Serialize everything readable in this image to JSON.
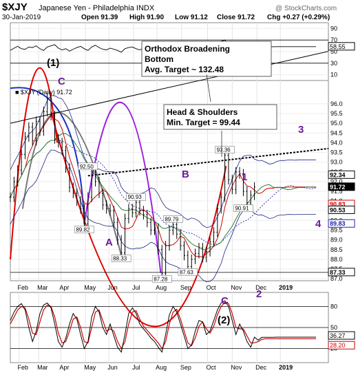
{
  "chart_data": {
    "type": "line",
    "title": "$XJY",
    "subtitle": "Japanese Yen - Philadelphia  INDX",
    "watermark": "@ StockCharts.com",
    "header": {
      "date": "30-Jan-2019",
      "open": "Open 91.39",
      "high": "High 91.90",
      "low": "Low 91.12",
      "close": "Close 91.72",
      "chg": "Chg +0.27 (+0.29%)"
    },
    "colors": {
      "price": "#000000",
      "ma_fast": "#cc0000",
      "ma_slow": "#2e7d32",
      "band": "#1a237e",
      "mid_band": "#2222aa",
      "annotation": "#6a1b9a",
      "red_cycle": "#e00000",
      "blue_cycle": "#1530c8",
      "purple_cycle": "#9c1ee0",
      "grey_cycle": "#777777",
      "oscillator_k": "#000000",
      "oscillator_d": "#cc0000"
    },
    "months": [
      "Feb",
      "Mar",
      "Apr",
      "May",
      "Jun",
      "Jul",
      "Aug",
      "Sep",
      "Oct",
      "Nov",
      "Dec",
      "2019"
    ],
    "price_panel": {
      "legend": "■ $XJY (Daily) 91.72",
      "ylim": [
        86.9,
        97.2
      ],
      "yticks": [
        "87.0",
        "87.5",
        "88.0",
        "88.5",
        "89.0",
        "89.5",
        "90.0",
        "90.5",
        "91.0",
        "91.5",
        "92.0",
        "92.5",
        "93.0",
        "93.5",
        "94.0",
        "94.5",
        "95.0",
        "95.5",
        "96.0"
      ],
      "price_labels": [
        "92.34",
        "91.72",
        "90.83",
        "90.53",
        "89.83",
        "87.33"
      ],
      "series": {
        "x": [
          0,
          3,
          6,
          9,
          12,
          15,
          18,
          21,
          24,
          27,
          30,
          33,
          36,
          39,
          42,
          45,
          48,
          51,
          54,
          57,
          60,
          63,
          66,
          69,
          72,
          75,
          78,
          81,
          84,
          87,
          90,
          93,
          96,
          99,
          102,
          105,
          108,
          111,
          114,
          117,
          120,
          123,
          126,
          129,
          132,
          135,
          138,
          141,
          144,
          147,
          150,
          153,
          156,
          159,
          162,
          165,
          168,
          171,
          174,
          177,
          180,
          183,
          186,
          189,
          192,
          195,
          198,
          201,
          204,
          207,
          210,
          213,
          216,
          219,
          222,
          225,
          228,
          231,
          234,
          237,
          240,
          243,
          246,
          248
        ],
        "values": [
          91.2,
          92.0,
          92.6,
          93.4,
          94.3,
          94.8,
          94.1,
          95.1,
          94.6,
          95.6,
          96.3,
          95.4,
          94.2,
          94.0,
          93.6,
          92.7,
          91.7,
          91.4,
          91.0,
          90.6,
          89.82,
          91.2,
          92.5,
          92.0,
          91.4,
          90.8,
          90.6,
          90.5,
          89.9,
          89.0,
          88.33,
          90.1,
          90.6,
          90.4,
          90.93,
          90.5,
          90.3,
          89.9,
          89.5,
          89.6,
          88.5,
          87.28,
          88.7,
          89.5,
          89.79,
          89.3,
          88.7,
          88.2,
          87.63,
          88.0,
          88.3,
          88.6,
          88.1,
          88.4,
          88.9,
          89.4,
          90.6,
          91.2,
          93.36,
          92.1,
          91.6,
          92.5,
          92.4,
          91.5,
          90.91,
          91.3,
          91.72,
          91.5,
          91.7,
          91.8,
          91.6,
          91.7,
          91.72,
          91.72,
          91.72,
          91.72,
          91.72,
          91.72,
          91.72,
          91.72,
          91.72,
          91.72,
          91.72,
          91.72
        ]
      },
      "annotations": [
        {
          "label": "89.82",
          "x": 60,
          "y": 89.82
        },
        {
          "label": "92.50",
          "x": 63,
          "y": 92.5
        },
        {
          "label": "88.33",
          "x": 90,
          "y": 88.33
        },
        {
          "label": "90.93",
          "x": 102,
          "y": 90.93
        },
        {
          "label": "89.79",
          "x": 132,
          "y": 89.79
        },
        {
          "label": "87.28",
          "x": 123,
          "y": 87.28
        },
        {
          "label": "87.63",
          "x": 144,
          "y": 87.63
        },
        {
          "label": "93.36",
          "x": 174,
          "y": 93.36
        },
        {
          "label": "90.91",
          "x": 189,
          "y": 90.91
        }
      ],
      "text_callouts": {
        "orthodox": "Orthodox Broadening\nBottom\nAvg. Target ~ 132.48",
        "head_shoulders": "Head & Shoulders\nMin. Target = 99.44"
      },
      "wave_labels": [
        "C",
        "A",
        "B",
        "1",
        "C",
        "2",
        "3",
        "4"
      ],
      "wave_sublabel": "(1)"
    },
    "rsi_panel": {
      "yticks": [
        "10",
        "30",
        "50",
        "70",
        "90"
      ],
      "value_label": "58.55",
      "values": [
        52,
        56,
        59,
        55,
        54,
        58,
        57,
        60,
        55,
        52,
        58,
        60,
        62,
        56,
        53,
        55,
        51,
        54,
        57,
        59,
        55,
        52,
        58,
        61,
        57,
        54,
        53,
        56,
        54,
        52,
        49,
        55,
        57,
        58,
        55,
        53,
        56,
        54,
        55,
        53,
        52,
        50,
        55,
        57,
        58,
        55,
        52,
        54,
        51,
        54,
        56,
        58,
        56,
        59,
        60,
        63,
        66,
        68,
        70,
        62,
        60,
        64,
        63,
        58,
        56,
        57,
        58.55,
        58,
        58.5,
        58.5,
        58.5,
        58.5,
        58.55,
        58.55,
        58.55,
        58.55,
        58.55,
        58.55,
        58.55,
        58.55,
        58.55,
        58.55,
        58.55,
        58.55
      ]
    },
    "stoch_panel": {
      "yticks": [
        "20",
        "50",
        "80"
      ],
      "value_labels": [
        "36.27",
        "28.20"
      ],
      "wave_label": "(2)",
      "k": [
        60,
        72,
        80,
        84,
        75,
        50,
        30,
        45,
        70,
        82,
        85,
        78,
        55,
        30,
        22,
        35,
        55,
        70,
        62,
        40,
        20,
        30,
        65,
        80,
        72,
        50,
        40,
        55,
        38,
        22,
        15,
        40,
        70,
        78,
        70,
        55,
        48,
        42,
        35,
        30,
        22,
        15,
        40,
        68,
        80,
        72,
        55,
        38,
        20,
        25,
        45,
        60,
        58,
        40,
        45,
        60,
        75,
        85,
        88,
        80,
        60,
        40,
        55,
        45,
        30,
        22,
        36.27,
        32,
        36,
        36,
        36,
        36,
        36.27,
        36.27,
        36.27,
        36.27,
        36.27,
        36.27,
        36.27,
        36.27,
        36.27,
        36.27,
        36.27,
        36.27
      ],
      "d": [
        55,
        65,
        75,
        80,
        78,
        62,
        42,
        40,
        58,
        75,
        82,
        80,
        65,
        42,
        28,
        30,
        45,
        62,
        65,
        50,
        30,
        28,
        50,
        72,
        75,
        60,
        45,
        48,
        45,
        30,
        20,
        30,
        55,
        72,
        74,
        62,
        52,
        46,
        40,
        34,
        28,
        20,
        30,
        55,
        72,
        76,
        62,
        45,
        28,
        24,
        35,
        52,
        58,
        48,
        42,
        52,
        68,
        80,
        86,
        84,
        70,
        50,
        48,
        48,
        38,
        28,
        28.2,
        30,
        33,
        34,
        34,
        34,
        34,
        34,
        34,
        34,
        34,
        34,
        34,
        34,
        34,
        34,
        34,
        34
      ]
    }
  }
}
